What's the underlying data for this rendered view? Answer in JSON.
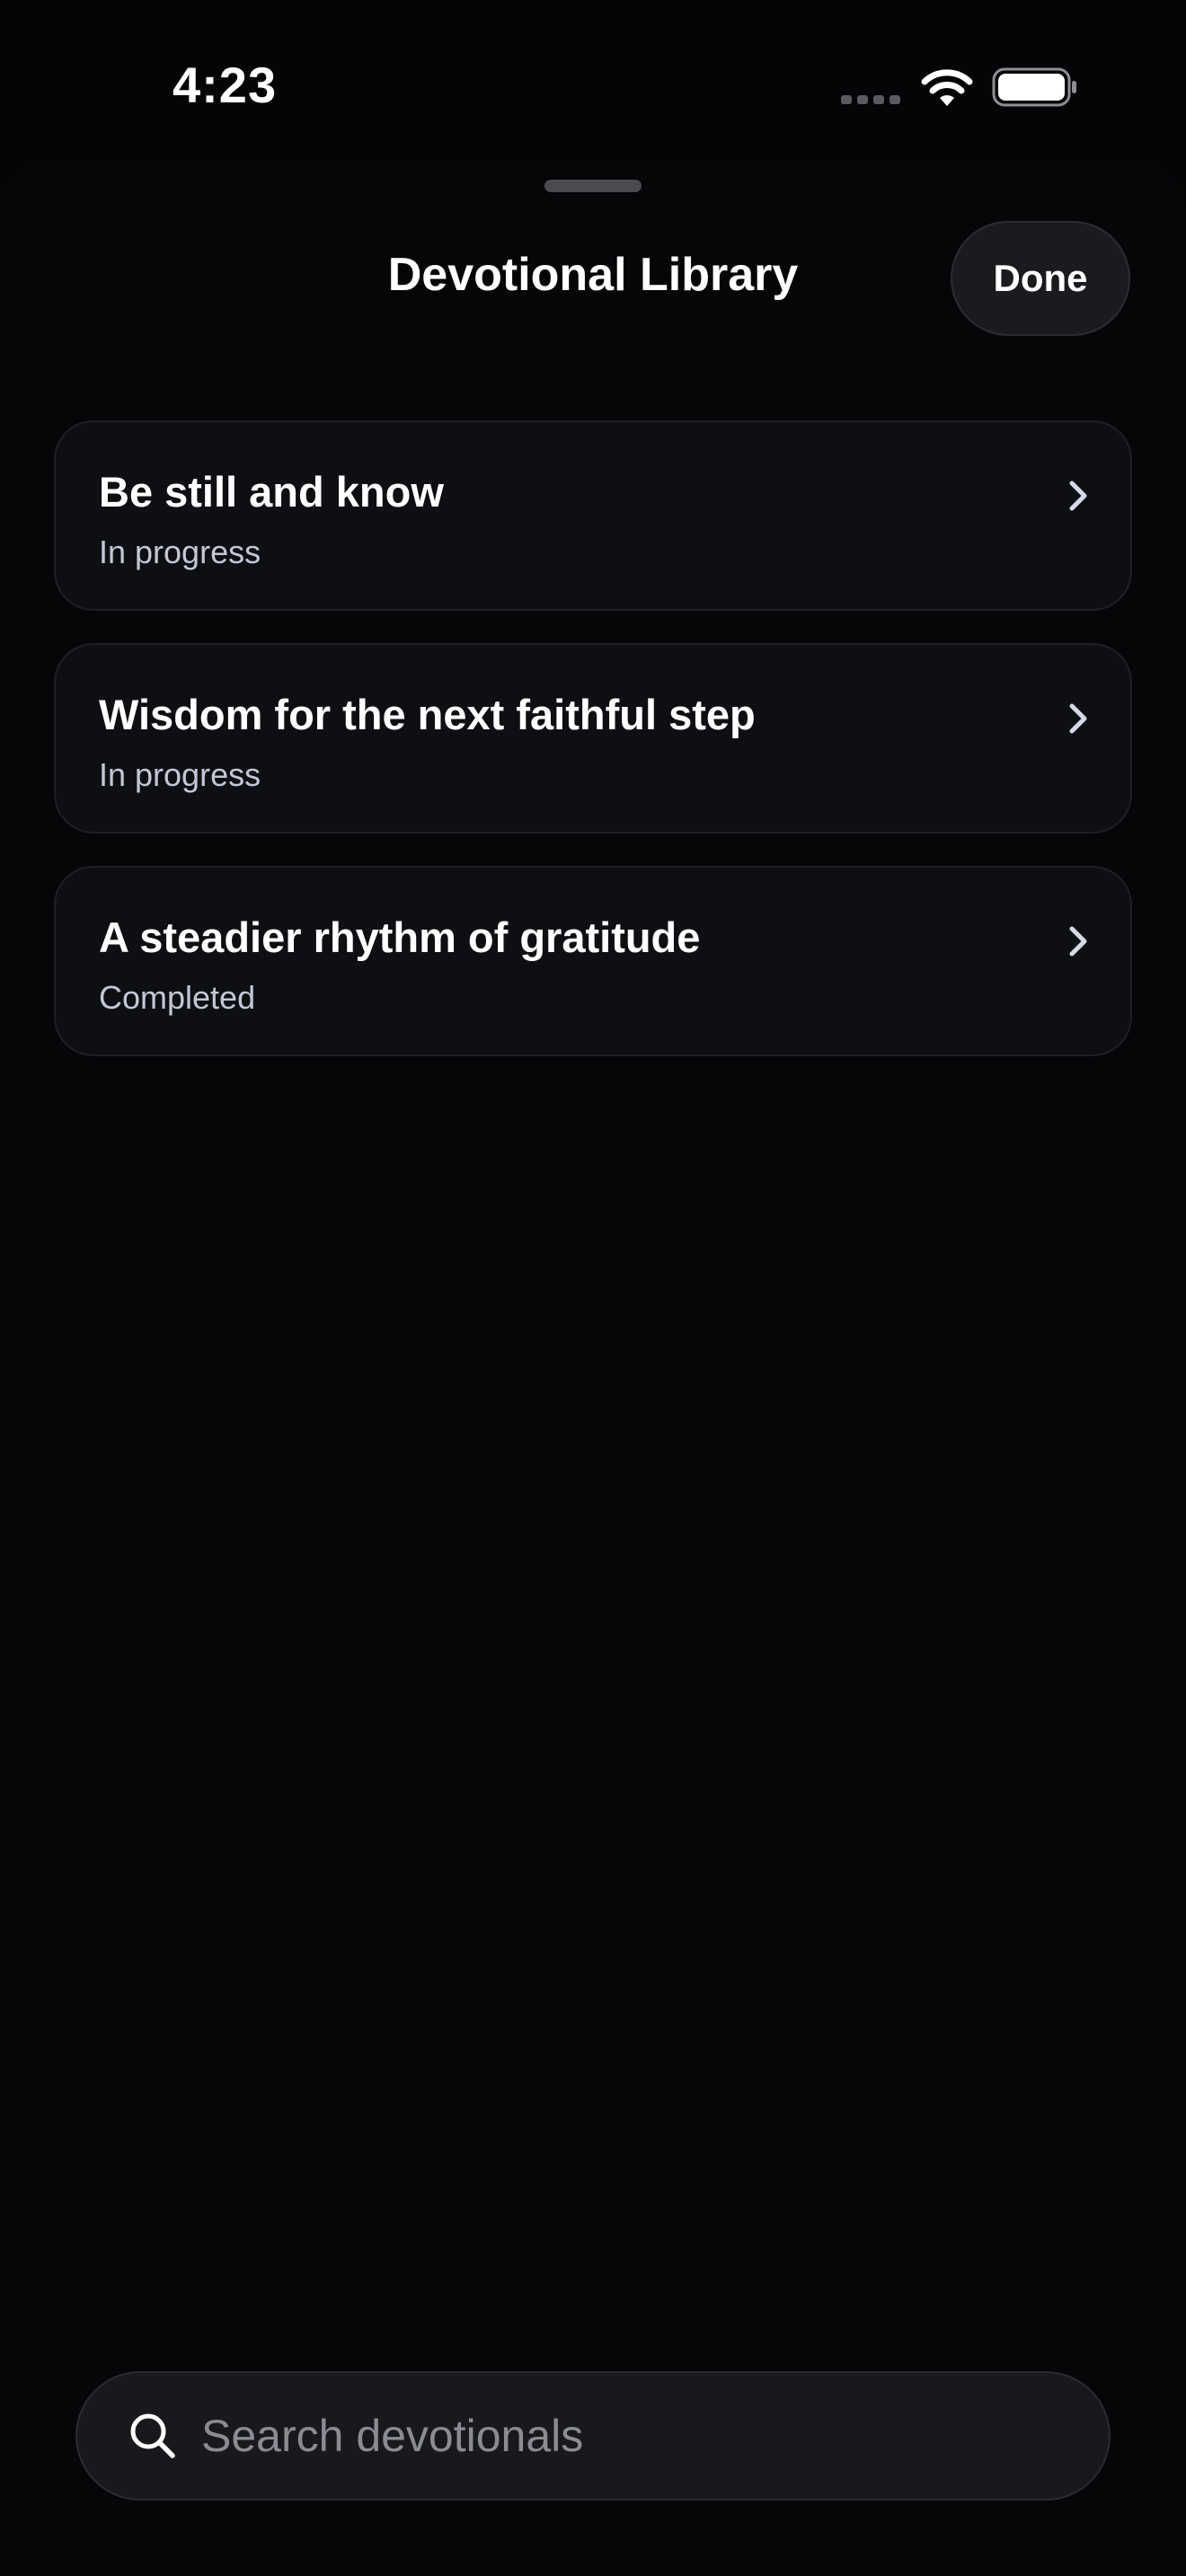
{
  "status_bar": {
    "time": "4:23"
  },
  "sheet": {
    "title": "Devotional Library",
    "done_label": "Done"
  },
  "devotionals": [
    {
      "title": "Be still and know",
      "status": "In progress"
    },
    {
      "title": "Wisdom for the next faithful step",
      "status": "In progress"
    },
    {
      "title": "A steadier rhythm of gratitude",
      "status": "Completed"
    }
  ],
  "search": {
    "placeholder": "Search devotionals",
    "value": ""
  },
  "icons": {
    "signal": "cellular-signal-icon",
    "wifi": "wifi-icon",
    "battery": "battery-icon",
    "chevron": "chevron-right-icon",
    "search": "search-icon"
  },
  "colors": {
    "background": "#050508",
    "card": "#0e0f13",
    "text_primary": "#ffffff",
    "text_secondary": "#c4c7d6",
    "placeholder": "#8a8b93"
  }
}
